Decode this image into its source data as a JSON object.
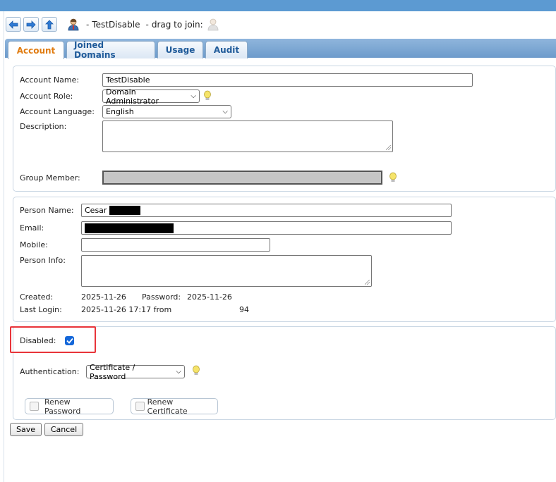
{
  "header": {
    "title": "TestDisable",
    "separator": "-",
    "drag_text": "drag to join:"
  },
  "tabs": [
    {
      "label": "Account",
      "active": true
    },
    {
      "label": "Joined Domains",
      "active": false
    },
    {
      "label": "Usage",
      "active": false
    },
    {
      "label": "Audit",
      "active": false
    }
  ],
  "account": {
    "name_label": "Account Name:",
    "name_value": "TestDisable",
    "role_label": "Account Role:",
    "role_value": "Domain Administrator",
    "language_label": "Account Language:",
    "language_value": "English",
    "description_label": "Description:",
    "description_value": "",
    "group_label": "Group Member:"
  },
  "person": {
    "name_label": "Person Name:",
    "name_value": "Cesar",
    "email_label": "Email:",
    "mobile_label": "Mobile:",
    "mobile_value": "",
    "info_label": "Person Info:",
    "created_label": "Created:",
    "created_value": "2025-11-26",
    "password_label": "Password:",
    "password_value": "2025-11-26",
    "last_login_label": "Last Login:",
    "last_login_value": "2025-11-26 17:17 from",
    "last_login_ip_tail": "94"
  },
  "security": {
    "disabled_label": "Disabled:",
    "disabled_checked": true,
    "auth_label": "Authentication:",
    "auth_value": "Certificate / Password",
    "renew_password_label": "Renew Password",
    "renew_certificate_label": "Renew Certificate"
  },
  "actions": {
    "save_label": "Save",
    "cancel_label": "Cancel"
  },
  "colors": {
    "topbar": "#5c9ad2",
    "active_tab_text": "#e07b0f",
    "tab_text": "#1f5a99",
    "highlight_border": "#e8343a",
    "checkbox": "#1467d9"
  }
}
